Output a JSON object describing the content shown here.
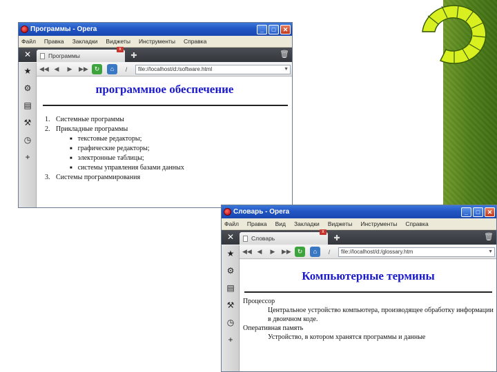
{
  "colors": {
    "accent_green": "#4e7e1a",
    "title_blue": "#1a1acc",
    "titlebar_blue": "#2156c4"
  },
  "logo": {
    "icon": "segmented-ring-logo"
  },
  "window1": {
    "title": "Программы - Opera",
    "menu": [
      "Файл",
      "Правка",
      "Закладки",
      "Виджеты",
      "Инструменты",
      "Справка"
    ],
    "tab_label": "Программы",
    "address": "file://localhost/d:/software.html",
    "page": {
      "title": "программное обеспечение",
      "items": [
        {
          "num": "1.",
          "text": "Системные программы"
        },
        {
          "num": "2.",
          "text": "Прикладные программы"
        },
        {
          "num": "3.",
          "text": "Системы программирования"
        }
      ],
      "subitems": [
        "текстовые редакторы;",
        "графические редакторы;",
        "электронные таблицы;",
        "системы управления базами данных"
      ]
    }
  },
  "window2": {
    "title": "Словарь - Opera",
    "menu": [
      "Файл",
      "Правка",
      "Вид",
      "Закладки",
      "Виджеты",
      "Инструменты",
      "Справка"
    ],
    "tab_label": "Словарь",
    "address": "file://localhost/d:/glossary.htm",
    "page": {
      "title": "Компьютерные термины",
      "terms": [
        {
          "term": "Процессор",
          "def": "Центральное устройство компьютера, производящее обработку информации в двоичном коде."
        },
        {
          "term": "Оперативная память",
          "def": "Устройство, в котором хранятся программы и данные"
        }
      ]
    }
  }
}
